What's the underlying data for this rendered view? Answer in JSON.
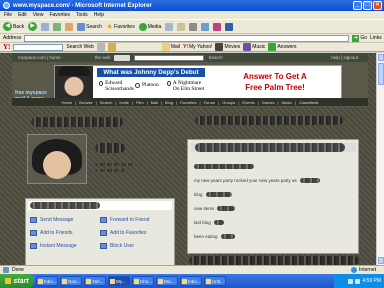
{
  "window": {
    "title": "www.myspace.com/ - Microsoft Internet Explorer",
    "controls": [
      "_",
      "□",
      "×"
    ]
  },
  "menu": [
    "File",
    "Edit",
    "View",
    "Favorites",
    "Tools",
    "Help"
  ],
  "toolbar": {
    "back": "Back",
    "forward": "",
    "search": "Search",
    "favorites": "Favorites",
    "media": "Media"
  },
  "address": {
    "label": "Address",
    "value": "",
    "go": "Go",
    "links": "Links"
  },
  "yahoo_bar": {
    "logo": "Y!",
    "search_web": "Search Web",
    "mail": "Mail",
    "my_yahoo": "My Yahoo!",
    "movies": "Movies",
    "music": "Music",
    "answers": "Answers"
  },
  "myspace": {
    "top_label": "myspace.com | home",
    "search_label": "the web",
    "search_btn": "Search",
    "top_links": "help | signout",
    "logo_line1": "free myspace",
    "logo_line2": "mail & more",
    "nav": [
      "Home",
      "Browse",
      "Search",
      "Invite",
      "Film",
      "Mail",
      "Blog",
      "Favorites",
      "Forum",
      "Groups",
      "Events",
      "Games",
      "Music",
      "Classifieds"
    ],
    "ad": {
      "question": "What was Johnny Depp's Debut Movie?",
      "options": [
        "Edward Scissorhands",
        "Platoon",
        "A Nightmare On Elm Street"
      ],
      "cta_line1": "Answer To Get A",
      "cta_line2": "Free Palm Tree!"
    },
    "contact": {
      "items": [
        "Send Message",
        "Forward to Friend",
        "Add to Friends",
        "Add to Favorites",
        "Instant Message",
        "Block User"
      ]
    },
    "right": {
      "line1": "my new years party rocked your new years party as",
      "line2": "blog",
      "line3": "new items",
      "line4": "last blog",
      "line5": "been eating"
    }
  },
  "status": {
    "left": "Done",
    "zone": "Internet"
  },
  "taskbar": {
    "start": "start",
    "tasks": [
      "Inbo...",
      "Goo...",
      "Yah...",
      "My...",
      "Cho...",
      "Mic...",
      "Inbo...",
      "Untl..."
    ],
    "clock": "4:59 PM"
  }
}
